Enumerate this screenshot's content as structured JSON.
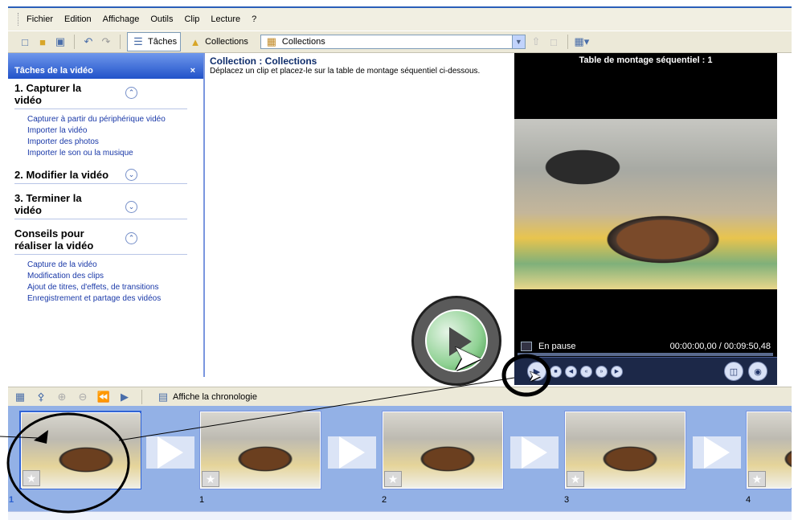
{
  "menu": {
    "items": [
      "Fichier",
      "Edition",
      "Affichage",
      "Outils",
      "Clip",
      "Lecture",
      "?"
    ]
  },
  "toolbar": {
    "tasks_label": "Tâches",
    "collections_label": "Collections",
    "collection_select_value": "Collections",
    "icons": [
      "new-project-icon",
      "open-icon",
      "save-icon",
      "undo-icon",
      "redo-icon"
    ]
  },
  "taskpane": {
    "title": "Tâches de la vidéo",
    "close": "×",
    "sections": [
      {
        "title": "1. Capturer la vidéo",
        "expanded": true,
        "links": [
          "Capturer à partir du périphérique vidéo",
          "Importer la vidéo",
          "Importer des photos",
          "Importer le son ou la musique"
        ]
      },
      {
        "title": "2. Modifier la vidéo",
        "expanded": false,
        "links": []
      },
      {
        "title": "3. Terminer la vidéo",
        "expanded": false,
        "links": []
      },
      {
        "title": "Conseils pour réaliser la vidéo",
        "expanded": true,
        "links": [
          "Capture de la vidéo",
          "Modification des clips",
          "Ajout de titres, d'effets, de transitions",
          "Enregistrement et partage des vidéos"
        ]
      }
    ]
  },
  "collection": {
    "title": "Collection : Collections",
    "instructions": "Déplacez un clip et placez-le sur la table de montage séquentiel ci-dessous."
  },
  "monitor": {
    "title": "Table de montage séquentiel : 1",
    "status": "En pause",
    "time": "00:00:00,00 / 00:09:50,48"
  },
  "storyboard": {
    "show_timeline_label": "Affiche la chronologie",
    "clips": [
      "1",
      "1",
      "2",
      "3",
      "4"
    ]
  },
  "colors": {
    "accent": "#2f62cf",
    "storyboard_bg": "#93b1e6"
  }
}
